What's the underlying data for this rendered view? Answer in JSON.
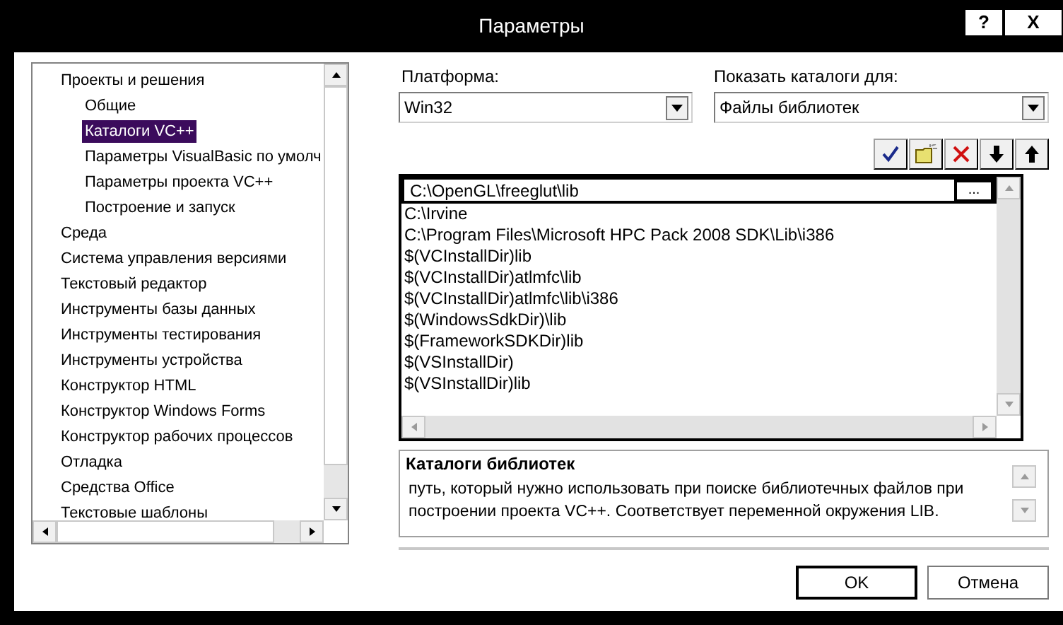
{
  "window": {
    "title": "Параметры",
    "title_buttons": [
      "?",
      "X"
    ]
  },
  "tree": {
    "items": [
      {
        "label": "Проекты и решения",
        "selected": false,
        "children": [
          {
            "label": "Общие",
            "selected": false
          },
          {
            "label": "Каталоги VC++",
            "selected": true
          },
          {
            "label": "Параметры VisualBasic по умолч",
            "selected": false
          },
          {
            "label": "Параметры проекта VC++",
            "selected": false
          },
          {
            "label": "Построение и запуск",
            "selected": false
          }
        ]
      },
      {
        "label": "Среда",
        "selected": false
      },
      {
        "label": "Система управления версиями",
        "selected": false
      },
      {
        "label": "Текстовый редактор",
        "selected": false
      },
      {
        "label": "Инструменты базы данных",
        "selected": false
      },
      {
        "label": "Инструменты тестирования",
        "selected": false
      },
      {
        "label": "Инструменты устройства",
        "selected": false
      },
      {
        "label": "Конструктор HTML",
        "selected": false
      },
      {
        "label": "Конструктор Windows Forms",
        "selected": false
      },
      {
        "label": "Конструктор рабочих процессов",
        "selected": false
      },
      {
        "label": "Отладка",
        "selected": false
      },
      {
        "label": "Средства Office",
        "selected": false
      },
      {
        "label": "Текстовые шаблоны",
        "selected": false
      }
    ]
  },
  "platform": {
    "label": "Платформа:",
    "value": "Win32"
  },
  "show_directories": {
    "label": "Показать каталоги для:",
    "value": "Файлы библиотек"
  },
  "directories": {
    "editing": "C:\\OpenGL\\freeglut\\lib",
    "browse_button": "...",
    "rows": [
      "C:\\Irvine",
      "C:\\Program Files\\Microsoft HPC Pack 2008 SDK\\Lib\\i386",
      "$(VCInstallDir)lib",
      "$(VCInstallDir)atlmfc\\lib",
      "$(VCInstallDir)atlmfc\\lib\\i386",
      "$(WindowsSdkDir)\\lib",
      "$(FrameworkSDKDir)lib",
      "$(VSInstallDir)",
      "$(VSInstallDir)lib"
    ]
  },
  "description": {
    "title": "Каталоги библиотек",
    "text": "путь, который нужно использовать при поиске библиотечных файлов при построении проекта VC++. Соответствует переменной окружения LIB."
  },
  "buttons": [
    "OK",
    "Отмена"
  ]
}
